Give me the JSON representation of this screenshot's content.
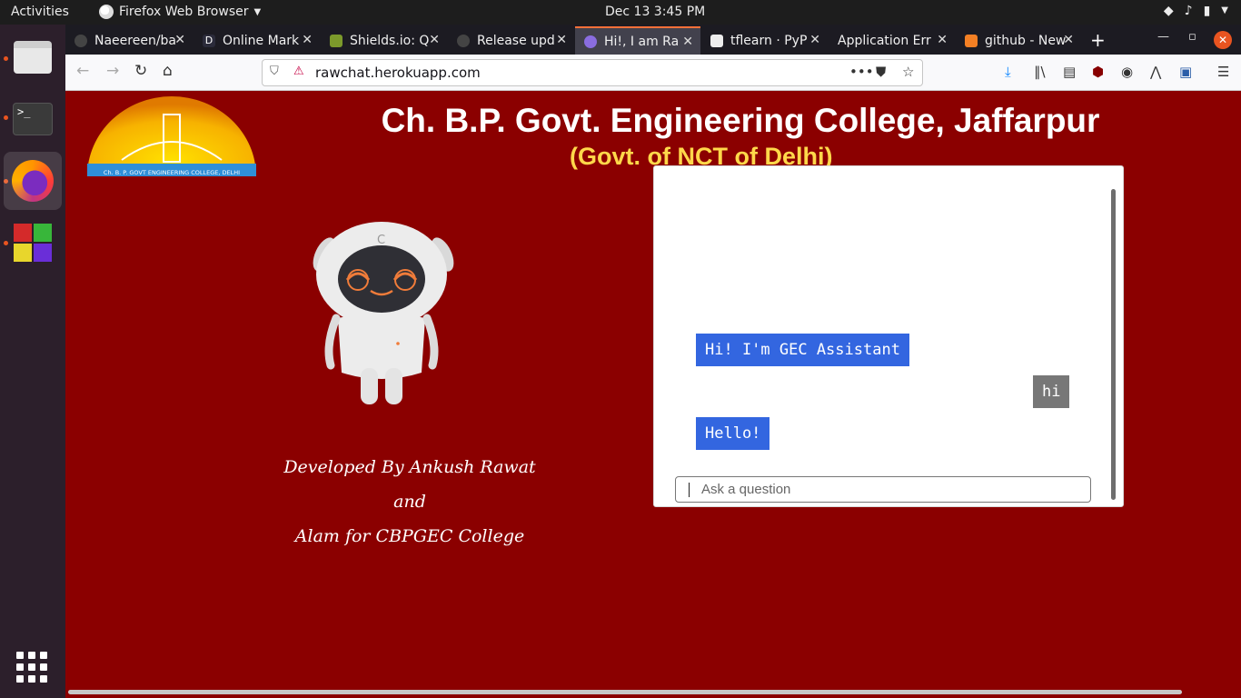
{
  "topbar": {
    "activities": "Activities",
    "app_name": "Firefox Web Browser",
    "clock": "Dec 13  3:45 PM"
  },
  "dock": {
    "items": [
      "files-icon",
      "terminal-icon",
      "firefox-icon",
      "software-icon",
      "show-apps-icon"
    ]
  },
  "browser": {
    "tabs": [
      {
        "label": "Naeereen/ba",
        "icon": "github-icon"
      },
      {
        "label": "Online Mark",
        "icon": "dillinger-icon"
      },
      {
        "label": "Shields.io: Q",
        "icon": "shields-icon"
      },
      {
        "label": "Release upd",
        "icon": "github-icon"
      },
      {
        "label": "Hi!, I am Ra",
        "icon": "robot-icon",
        "active": true
      },
      {
        "label": "tflearn · PyP",
        "icon": "pypi-icon"
      },
      {
        "label": "Application Err",
        "icon": "heroku-icon"
      },
      {
        "label": "github - New",
        "icon": "stackoverflow-icon"
      }
    ],
    "url": "rawchat.herokuapp.com"
  },
  "page": {
    "college_name": "Ch. B.P. Govt. Engineering College, Jaffarpur",
    "college_sub": "(Govt. of NCT of Delhi)",
    "logo_text": "Ch. B. P. GOVT ENGINEERING COLLEGE, DELHI",
    "credit_line1": "Developed By Ankush Rawat and",
    "credit_line2": "Alam for CBPGEC College"
  },
  "chat": {
    "messages": [
      {
        "from": "bot",
        "text": "Hi! I'm GEC Assistant"
      },
      {
        "from": "user",
        "text": "hi"
      },
      {
        "from": "bot",
        "text": "Hello!"
      }
    ],
    "input_placeholder": "Ask a question"
  },
  "colors": {
    "page_bg": "#8b0000",
    "bot_bubble": "#3366e0",
    "user_bubble": "#777777",
    "subtitle": "#ffd84a"
  }
}
